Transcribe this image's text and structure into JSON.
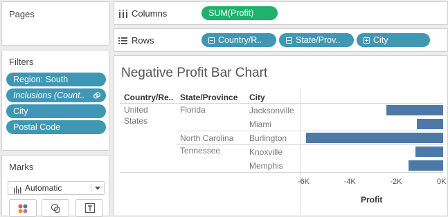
{
  "pages_card": {
    "title": "Pages"
  },
  "filters_card": {
    "title": "Filters",
    "items": [
      {
        "label": "Region: South"
      },
      {
        "label": "Inclusions (Count.."
      },
      {
        "label": "City"
      },
      {
        "label": "Postal Code"
      }
    ]
  },
  "marks_card": {
    "title": "Marks",
    "mark_type": "Automatic"
  },
  "columns_shelf": {
    "label": "Columns",
    "pills": [
      "SUM(Profit)"
    ]
  },
  "rows_shelf": {
    "label": "Rows",
    "pills": [
      "Country/R..",
      "State/Prov..",
      "City"
    ]
  },
  "view": {
    "title": "Negative Profit Bar Chart",
    "headers": {
      "country": "Country/Re..",
      "state": "State/Province",
      "city": "City"
    },
    "country_line1": "United",
    "country_line2": "States",
    "x_axis_title": "Profit"
  },
  "chart_data": {
    "type": "bar",
    "orientation": "horizontal",
    "xlabel": "Profit",
    "xlim": [
      -6000,
      0
    ],
    "x_ticks": [
      "-6K",
      "-4K",
      "-2K",
      "0K"
    ],
    "rows": [
      {
        "country": "United States",
        "state": "Florida",
        "city": "Jacksonville",
        "value": -2450
      },
      {
        "country": "United States",
        "state": "Florida",
        "city": "Miami",
        "value": -1150
      },
      {
        "country": "United States",
        "state": "North Carolina",
        "city": "Burlington",
        "value": -5950
      },
      {
        "country": "United States",
        "state": "Tennessee",
        "city": "Knoxville",
        "value": -1200
      },
      {
        "country": "United States",
        "state": "Tennessee",
        "city": "Memphis",
        "value": -1500
      }
    ],
    "bar_color": "#4e79a7"
  },
  "colors": {
    "pill": "#3f97b4",
    "measure_pill": "#20b16b"
  }
}
